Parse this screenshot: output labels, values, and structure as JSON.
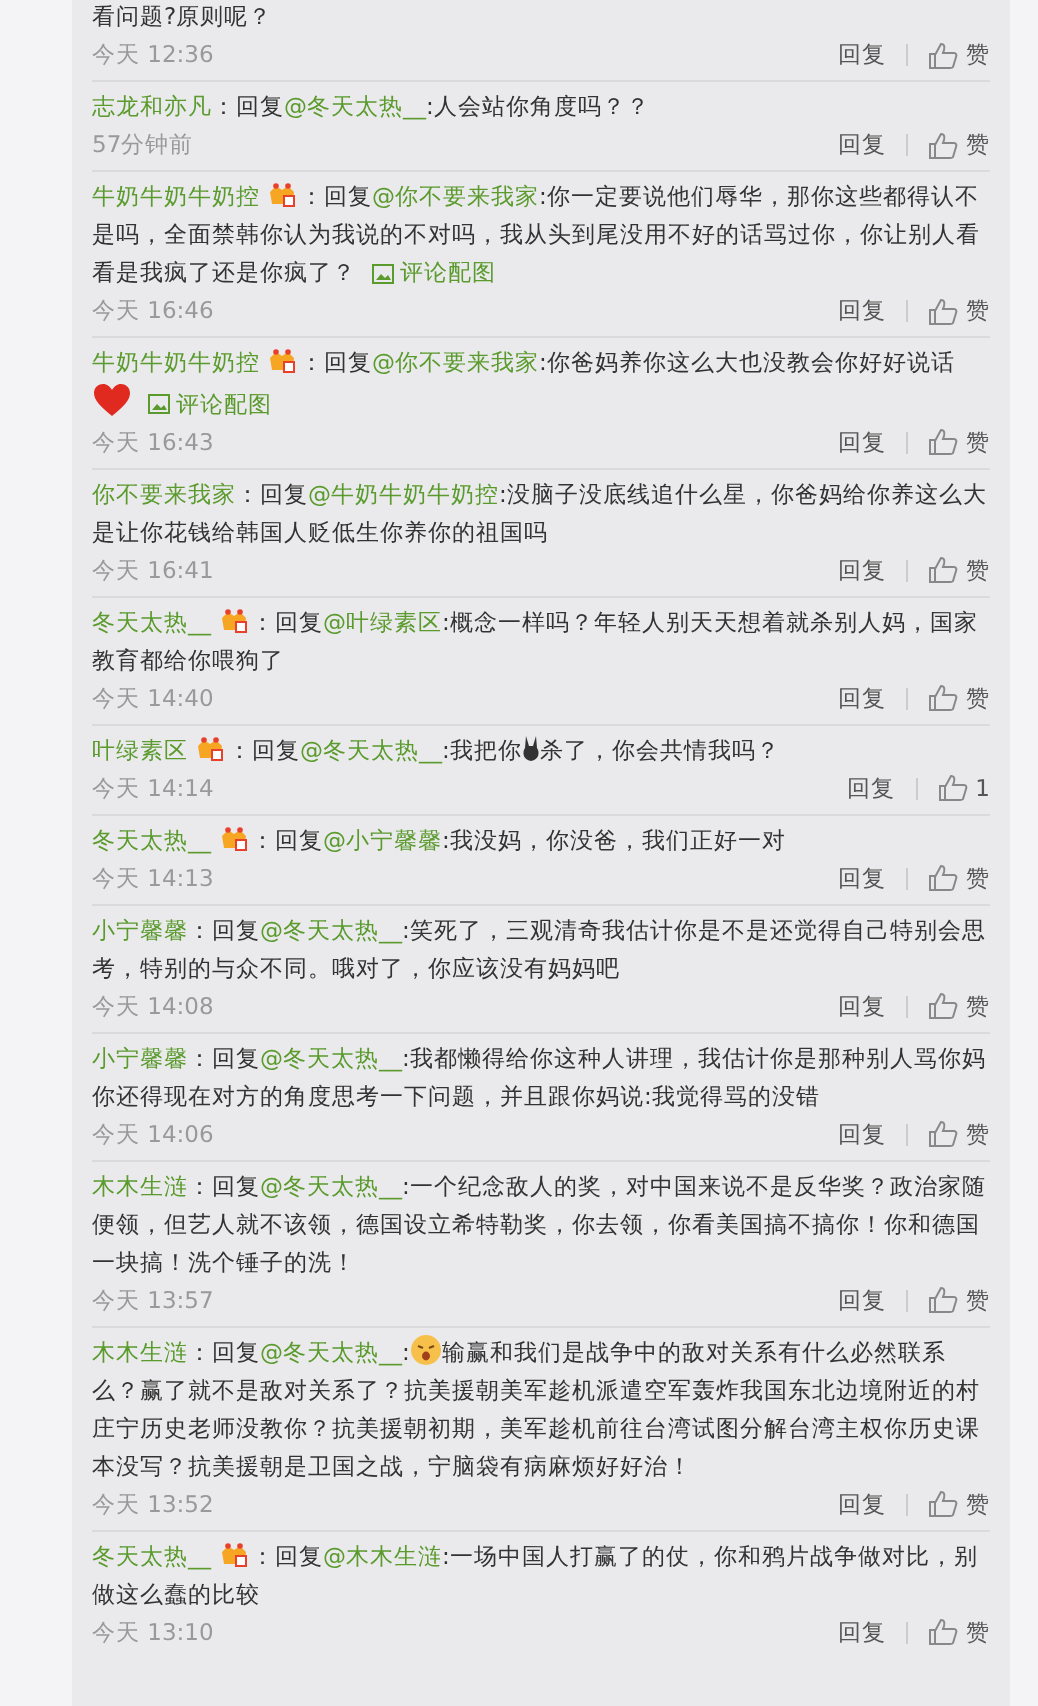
{
  "comments": [
    {
      "segments": [
        {
          "kind": "text",
          "text": "看问题?原则呢？"
        }
      ],
      "time": "今天 12:36",
      "reply": "回复",
      "like": "赞"
    },
    {
      "segments": [
        {
          "kind": "user",
          "text": "志龙和亦凡"
        },
        {
          "kind": "text",
          "text": "：回复"
        },
        {
          "kind": "mention",
          "text": "@冬天太热__"
        },
        {
          "kind": "text",
          "text": ":人会站你角度吗？？"
        }
      ],
      "time": "57分钟前",
      "reply": "回复",
      "like": "赞"
    },
    {
      "segments": [
        {
          "kind": "user",
          "text": "牛奶牛奶牛奶控"
        },
        {
          "kind": "vip"
        },
        {
          "kind": "text",
          "text": "：回复"
        },
        {
          "kind": "mention",
          "text": "@你不要来我家"
        },
        {
          "kind": "text",
          "text": ":你一定要说他们辱华，那你这些都得认不是吗，全面禁韩你认为我说的不对吗，我从头到尾没用不好的话骂过你，你让别人看看是我疯了还是你疯了？"
        },
        {
          "kind": "pic_link",
          "text": "评论配图"
        }
      ],
      "time": "今天 16:46",
      "reply": "回复",
      "like": "赞"
    },
    {
      "segments": [
        {
          "kind": "user",
          "text": "牛奶牛奶牛奶控"
        },
        {
          "kind": "vip"
        },
        {
          "kind": "text",
          "text": "：回复"
        },
        {
          "kind": "mention",
          "text": "@你不要来我家"
        },
        {
          "kind": "text",
          "text": ":你爸妈养你这么大也没教会你好好说话"
        },
        {
          "kind": "heart"
        },
        {
          "kind": "pic_link",
          "text": "评论配图"
        }
      ],
      "time": "今天 16:43",
      "reply": "回复",
      "like": "赞"
    },
    {
      "segments": [
        {
          "kind": "user",
          "text": "你不要来我家"
        },
        {
          "kind": "text",
          "text": "：回复"
        },
        {
          "kind": "mention",
          "text": "@牛奶牛奶牛奶控"
        },
        {
          "kind": "text",
          "text": ":没脑子没底线追什么星，你爸妈给你养这么大是让你花钱给韩国人贬低生你养你的祖国吗"
        }
      ],
      "time": "今天 16:41",
      "reply": "回复",
      "like": "赞"
    },
    {
      "segments": [
        {
          "kind": "user",
          "text": "冬天太热__"
        },
        {
          "kind": "vip"
        },
        {
          "kind": "text",
          "text": "：回复"
        },
        {
          "kind": "mention",
          "text": "@叶绿素区"
        },
        {
          "kind": "text",
          "text": ":概念一样吗？年轻人别天天想着就杀别人妈，国家教育都给你喂狗了"
        }
      ],
      "time": "今天 14:40",
      "reply": "回复",
      "like": "赞"
    },
    {
      "segments": [
        {
          "kind": "user",
          "text": "叶绿素区"
        },
        {
          "kind": "vip"
        },
        {
          "kind": "text",
          "text": "：回复"
        },
        {
          "kind": "mention",
          "text": "@冬天太热__"
        },
        {
          "kind": "text",
          "text": ":我把你"
        },
        {
          "kind": "bunny"
        },
        {
          "kind": "text",
          "text": "杀了，你会共情我吗？"
        }
      ],
      "time": "今天 14:14",
      "reply": "回复",
      "like": "1"
    },
    {
      "segments": [
        {
          "kind": "user",
          "text": "冬天太热__"
        },
        {
          "kind": "vip"
        },
        {
          "kind": "text",
          "text": "：回复"
        },
        {
          "kind": "mention",
          "text": "@小宁馨馨"
        },
        {
          "kind": "text",
          "text": ":我没妈，你没爸，我们正好一对"
        }
      ],
      "time": "今天 14:13",
      "reply": "回复",
      "like": "赞"
    },
    {
      "segments": [
        {
          "kind": "user",
          "text": "小宁馨馨"
        },
        {
          "kind": "text",
          "text": "：回复"
        },
        {
          "kind": "mention",
          "text": "@冬天太热__"
        },
        {
          "kind": "text",
          "text": ":笑死了，三观清奇我估计你是不是还觉得自己特别会思考，特别的与众不同。哦对了，你应该没有妈妈吧"
        }
      ],
      "time": "今天 14:08",
      "reply": "回复",
      "like": "赞"
    },
    {
      "segments": [
        {
          "kind": "user",
          "text": "小宁馨馨"
        },
        {
          "kind": "text",
          "text": "：回复"
        },
        {
          "kind": "mention",
          "text": "@冬天太热__"
        },
        {
          "kind": "text",
          "text": ":我都懒得给你这种人讲理，我估计你是那种别人骂你妈你还得现在对方的角度思考一下问题，并且跟你妈说:我觉得骂的没错"
        }
      ],
      "time": "今天 14:06",
      "reply": "回复",
      "like": "赞"
    },
    {
      "segments": [
        {
          "kind": "user",
          "text": "木木生涟"
        },
        {
          "kind": "text",
          "text": "：回复"
        },
        {
          "kind": "mention",
          "text": "@冬天太热__"
        },
        {
          "kind": "text",
          "text": ":一个纪念敌人的奖，对中国来说不是反华奖？政治家随便领，但艺人就不该领，德国设立希特勒奖，你去领，你看美国搞不搞你！你和德国一块搞！洗个锤子的洗！"
        }
      ],
      "time": "今天 13:57",
      "reply": "回复",
      "like": "赞"
    },
    {
      "segments": [
        {
          "kind": "user",
          "text": "木木生涟"
        },
        {
          "kind": "text",
          "text": "：回复"
        },
        {
          "kind": "mention",
          "text": "@冬天太热__"
        },
        {
          "kind": "text",
          "text": ":"
        },
        {
          "kind": "face"
        },
        {
          "kind": "text",
          "text": "输赢和我们是战争中的敌对关系有什么必然联系么？赢了就不是敌对关系了？抗美援朝美军趁机派遣空军轰炸我国东北边境附近的村庄宁历史老师没教你？抗美援朝初期，美军趁机前往台湾试图分解台湾主权你历史课本没写？抗美援朝是卫国之战，宁脑袋有病麻烦好好治！"
        }
      ],
      "time": "今天 13:52",
      "reply": "回复",
      "like": "赞"
    },
    {
      "segments": [
        {
          "kind": "user",
          "text": "冬天太热__"
        },
        {
          "kind": "vip"
        },
        {
          "kind": "text",
          "text": "：回复"
        },
        {
          "kind": "mention",
          "text": "@木木生涟"
        },
        {
          "kind": "text",
          "text": ":一场中国人打赢了的仗，你和鸦片战争做对比，别做这么蠢的比较"
        }
      ],
      "time": "今天 13:10",
      "reply": "回复",
      "like": "赞"
    }
  ]
}
